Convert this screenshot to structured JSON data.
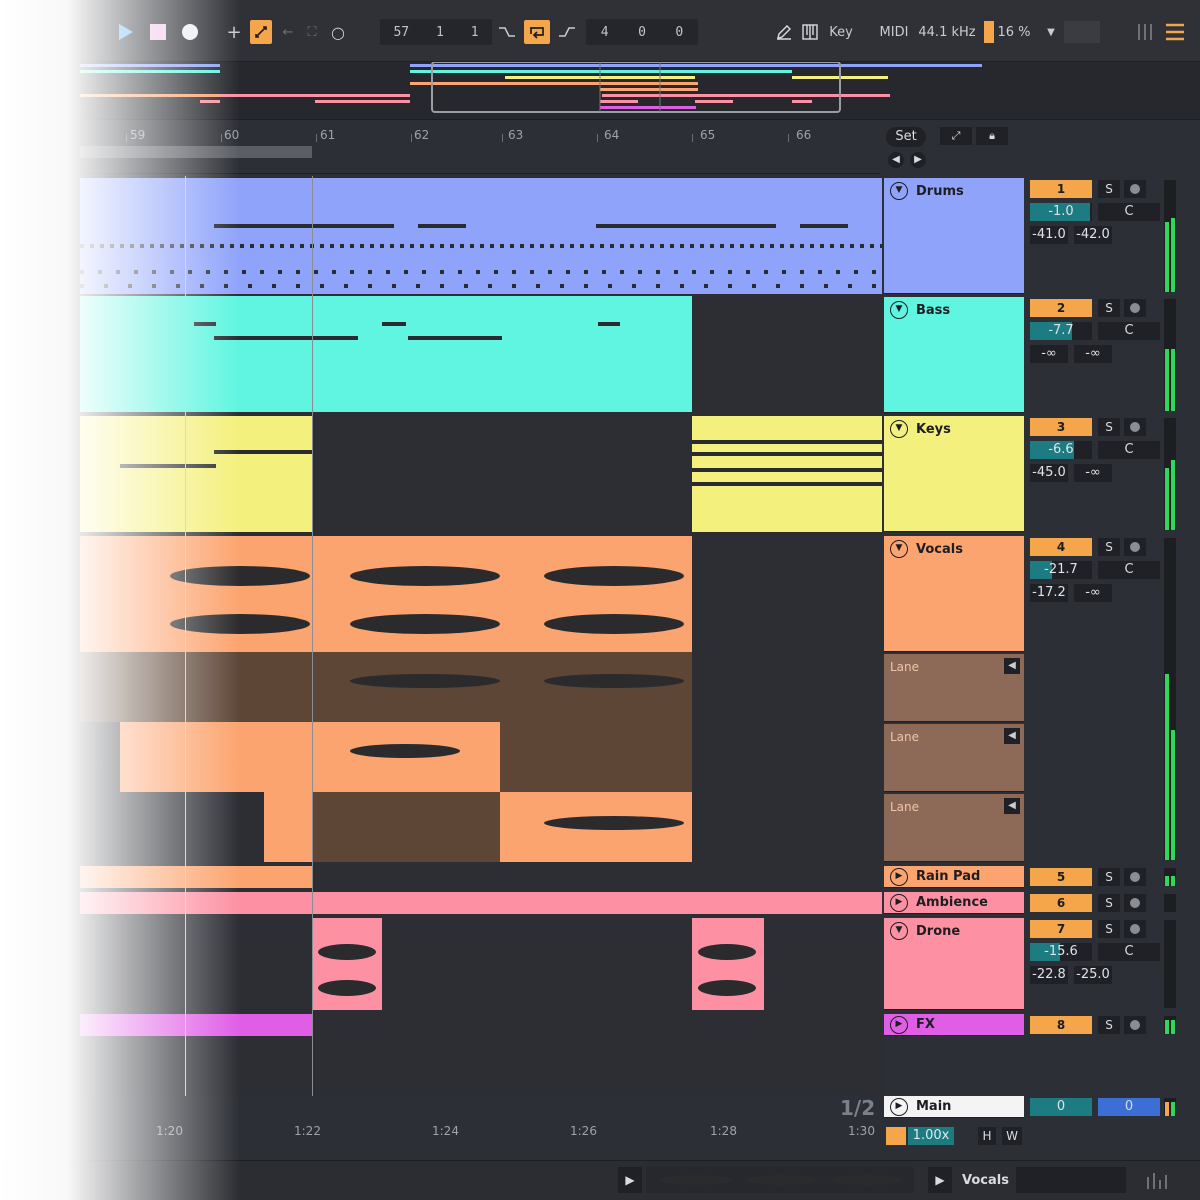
{
  "toolbar": {
    "play_icon": "play-icon",
    "position": [
      "57",
      "1",
      "1"
    ],
    "loop_length": [
      "4",
      "0",
      "0"
    ],
    "key_label": "Key",
    "midi_label": "MIDI",
    "sample_rate": "44.1 kHz",
    "cpu": "16 %"
  },
  "ruler": {
    "bars": [
      "59",
      "60",
      "61",
      "62",
      "63",
      "64",
      "65",
      "66"
    ],
    "set_label": "Set"
  },
  "tracks": [
    {
      "name": "Drums",
      "number": "1",
      "solo": "S",
      "volume": "-1.0",
      "pan": "C",
      "send_a": "-41.0",
      "send_b": "-42.0",
      "color": "#8fa3fb"
    },
    {
      "name": "Bass",
      "number": "2",
      "solo": "S",
      "volume": "-7.7",
      "pan": "C",
      "send_a": "-∞",
      "send_b": "-∞",
      "color": "#5ff5e0"
    },
    {
      "name": "Keys",
      "number": "3",
      "solo": "S",
      "volume": "-6.6",
      "pan": "C",
      "send_a": "-45.0",
      "send_b": "-∞",
      "color": "#f4f07d"
    },
    {
      "name": "Vocals",
      "number": "4",
      "solo": "S",
      "volume": "-21.7",
      "pan": "C",
      "send_a": "-17.2",
      "send_b": "-∞",
      "color": "#fca46f"
    },
    {
      "name": "Rain Pad",
      "number": "5",
      "solo": "S",
      "color": "#fca46f"
    },
    {
      "name": "Ambience",
      "number": "6",
      "solo": "S",
      "color": "#fd91a3"
    },
    {
      "name": "Drone",
      "number": "7",
      "solo": "S",
      "volume": "-15.6",
      "pan": "C",
      "send_a": "-22.8",
      "send_b": "-25.0",
      "color": "#fd91a3"
    },
    {
      "name": "FX",
      "number": "8",
      "solo": "S",
      "color": "#e05ee6"
    }
  ],
  "lanes": [
    "Lane",
    "Lane",
    "Lane"
  ],
  "main": {
    "name": "Main",
    "number": "0",
    "value": "0"
  },
  "page_indicator": "1/2",
  "time_ruler": [
    "1:20",
    "1:22",
    "1:24",
    "1:26",
    "1:28",
    "1:30"
  ],
  "zoom": "1.00x",
  "h_label": "H",
  "w_label": "W",
  "status": {
    "clip_name": "Vocals"
  }
}
